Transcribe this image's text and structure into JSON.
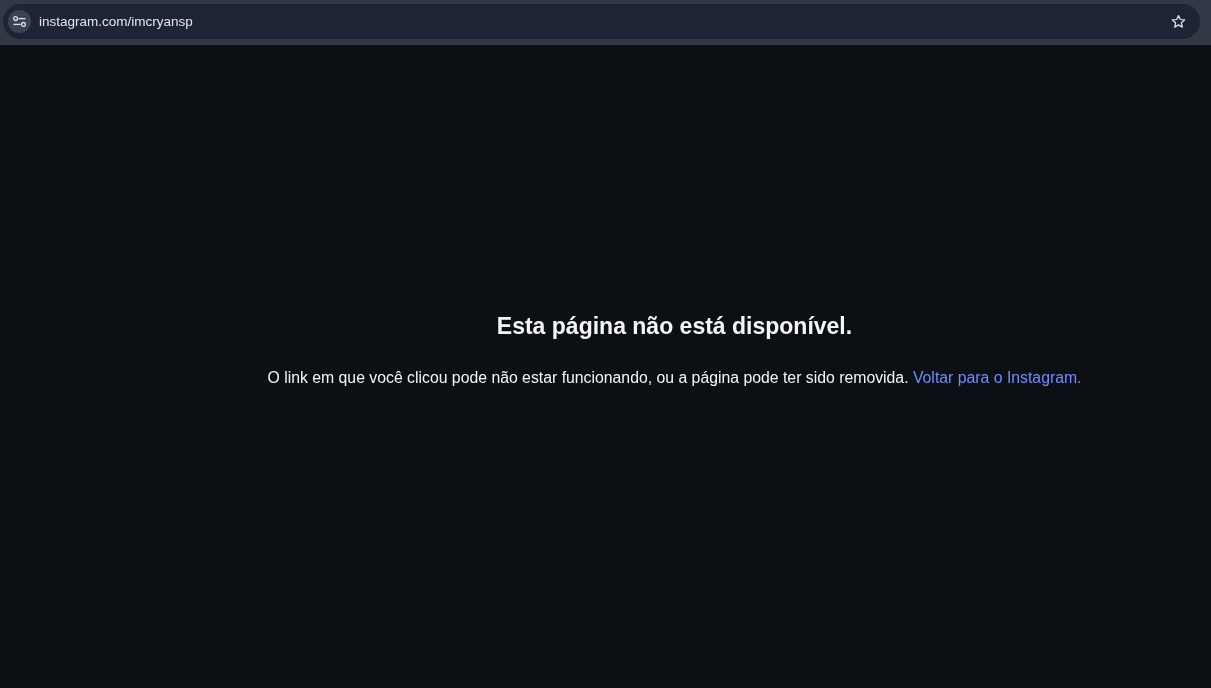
{
  "browser": {
    "url": "instagram.com/imcryansp"
  },
  "page": {
    "title": "Esta página não está disponível.",
    "message": "O link em que você clicou pode não estar funcionando, ou a página pode ter sido removida.",
    "link": "Voltar para o Instagram."
  }
}
